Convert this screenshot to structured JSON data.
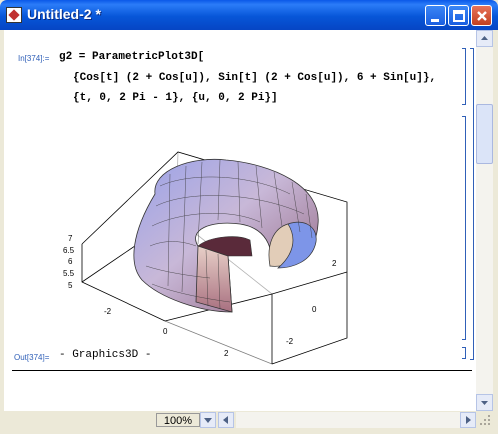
{
  "window": {
    "title": "Untitled-2 *"
  },
  "notebook": {
    "input_label": "In[374]:=",
    "input_lines": [
      "g2 = ParametricPlot3D[",
      "{Cos[t] (2 + Cos[u]), Sin[t] (2 + Cos[u]), 6 + Sin[u]},",
      "{t, 0, 2 Pi - 1}, {u, 0, 2 Pi}]"
    ],
    "output_label": "Out[374]=",
    "output_text": "- Graphics3D -",
    "plot": {
      "z_ticks": [
        "7",
        "6.5",
        "6",
        "5.5",
        "5"
      ],
      "x_ticks": [
        "-2",
        "0",
        "2"
      ],
      "y_ticks": [
        "-2",
        "0",
        "2"
      ]
    }
  },
  "status": {
    "zoom": "100%"
  }
}
